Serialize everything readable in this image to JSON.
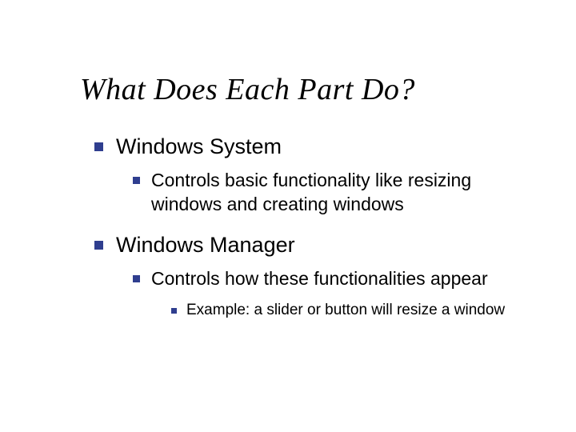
{
  "title": "What Does Each Part Do?",
  "sections": [
    {
      "heading": "Windows System",
      "points": [
        {
          "text": "Controls basic functionality like resizing windows and creating windows"
        }
      ]
    },
    {
      "heading": "Windows Manager",
      "points": [
        {
          "text": "Controls how these functionalities appear",
          "subpoints": [
            {
              "text": "Example: a slider or button will resize a window"
            }
          ]
        }
      ]
    }
  ]
}
